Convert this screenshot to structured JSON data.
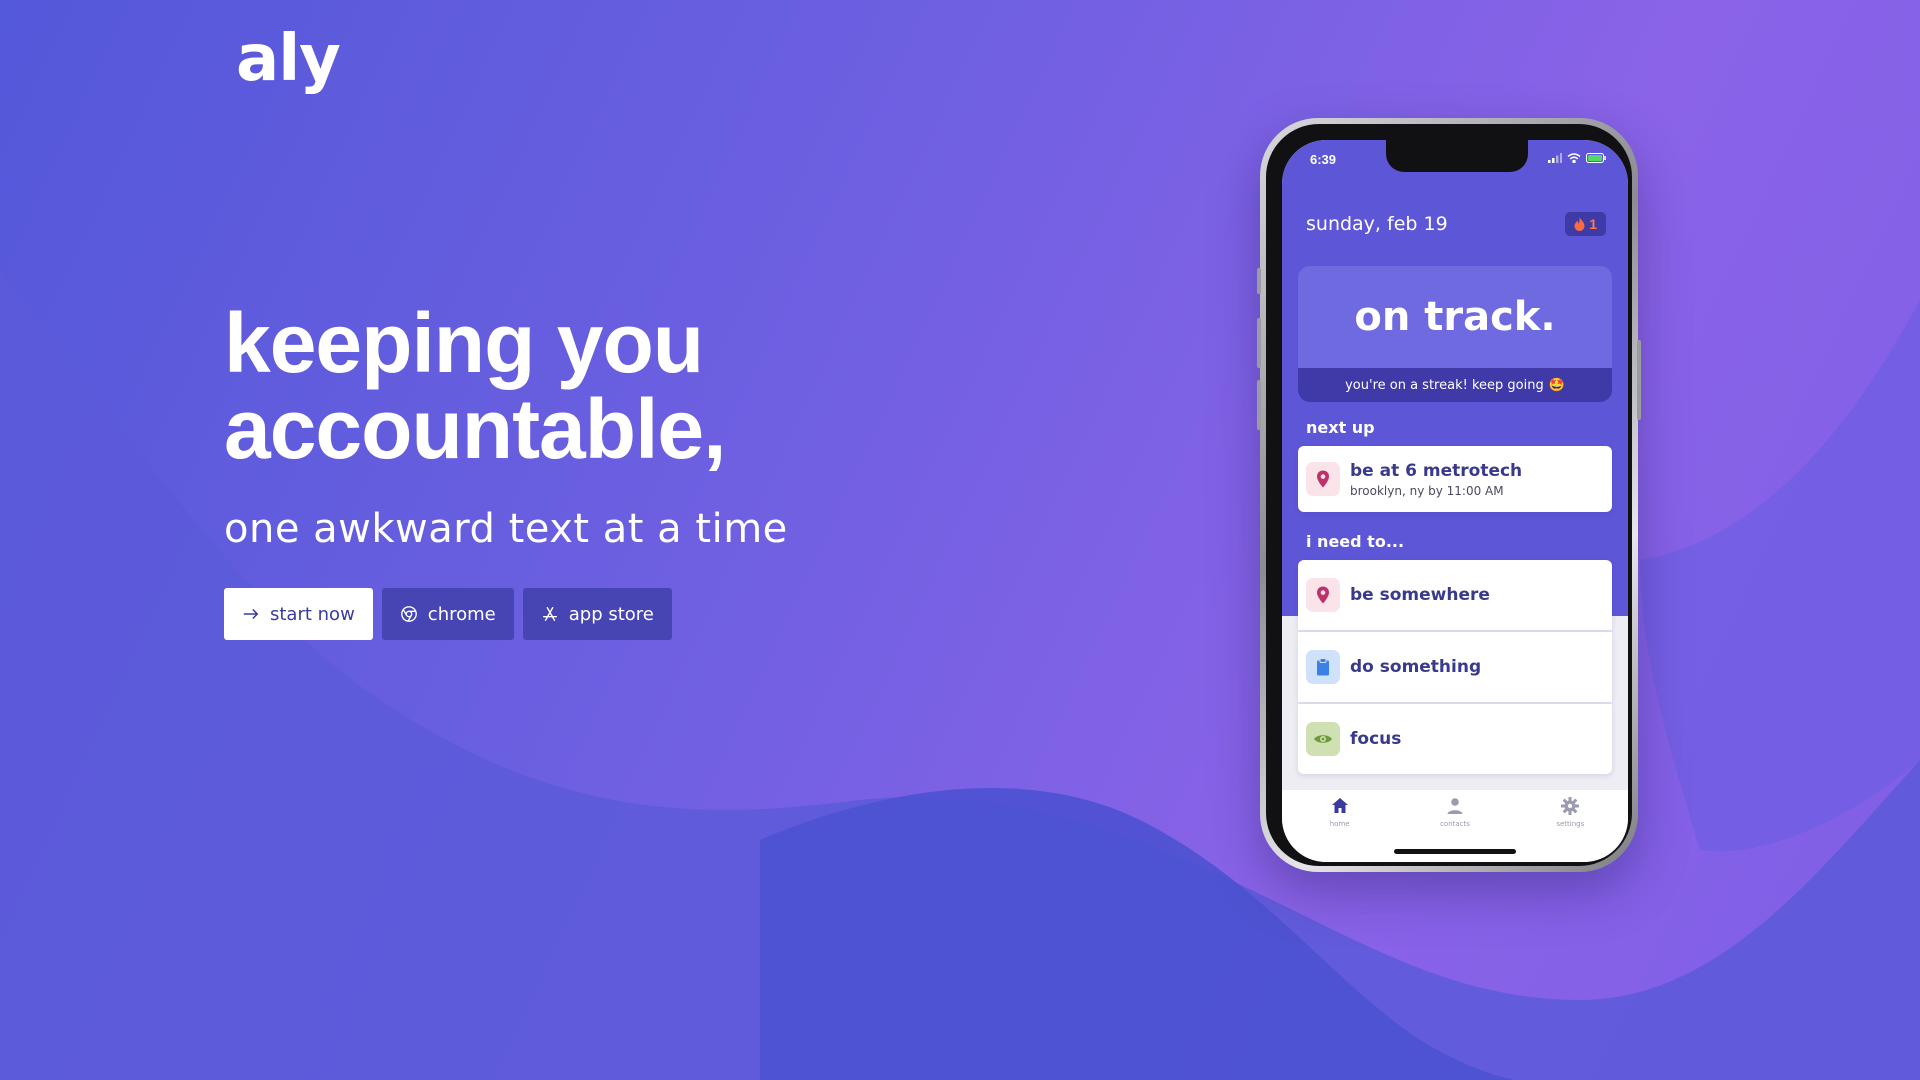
{
  "brand": {
    "logo_text": "aly"
  },
  "hero": {
    "headline_line1": "keeping you",
    "headline_line2": "accountable,",
    "subhead": "one awkward text at a time"
  },
  "cta": {
    "start_now": "start now",
    "chrome": "chrome",
    "app_store": "app store"
  },
  "phone": {
    "status_time": "6:39",
    "date": "sunday, feb 19",
    "streak_count": "1",
    "status_title": "on track.",
    "status_message": "you're on a streak! keep going",
    "status_emoji": "🤩",
    "next_up_label": "next up",
    "next_up": {
      "title": "be at 6 metrotech",
      "subtitle": "brooklyn, ny by 11:00 AM"
    },
    "need_to_label": "i need to...",
    "actions": [
      {
        "label": "be somewhere",
        "icon": "location-pin-icon"
      },
      {
        "label": "do something",
        "icon": "clipboard-icon"
      },
      {
        "label": "focus",
        "icon": "eye-icon"
      }
    ],
    "tabs": [
      {
        "label": "home",
        "icon": "home-icon"
      },
      {
        "label": "contacts",
        "icon": "person-icon"
      },
      {
        "label": "settings",
        "icon": "gear-icon"
      }
    ]
  },
  "colors": {
    "background_start": "#5458da",
    "background_end": "#8a63e8",
    "button_dark": "#4745b4",
    "phone_screen": "#5d57d7",
    "card_title": "#3a3a8c"
  }
}
